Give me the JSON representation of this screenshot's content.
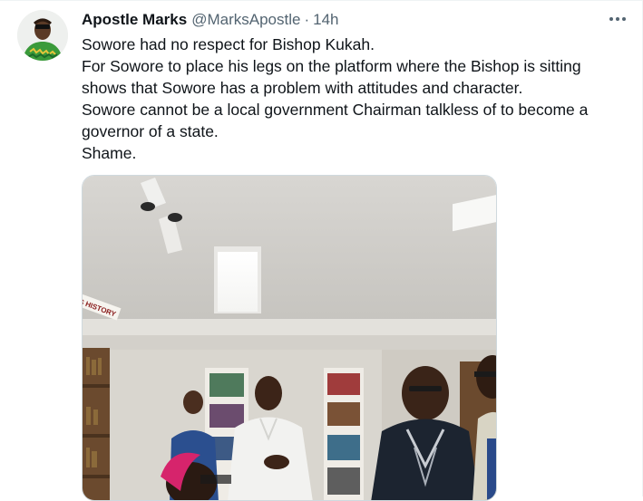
{
  "tweet": {
    "display_name": "Apostle Marks",
    "handle": "@MarksApostle",
    "separator": "·",
    "time": "14h",
    "text_lines": [
      "Sowore had no respect for Bishop Kukah.",
      "For Sowore to place his legs on the platform where the Bishop is sitting",
      "shows that Sowore has a problem with attitudes and character.",
      "Sowore cannot be a local government Chairman talkless of to become a",
      "governor of a state.",
      "Shame."
    ],
    "photo_sign_text": "S HISTORY"
  },
  "icons": {
    "more": "more-horizontal-icon",
    "avatar": "avatar"
  },
  "colors": {
    "text_primary": "#0f1419",
    "text_secondary": "#536471",
    "border": "#cfd9de"
  }
}
